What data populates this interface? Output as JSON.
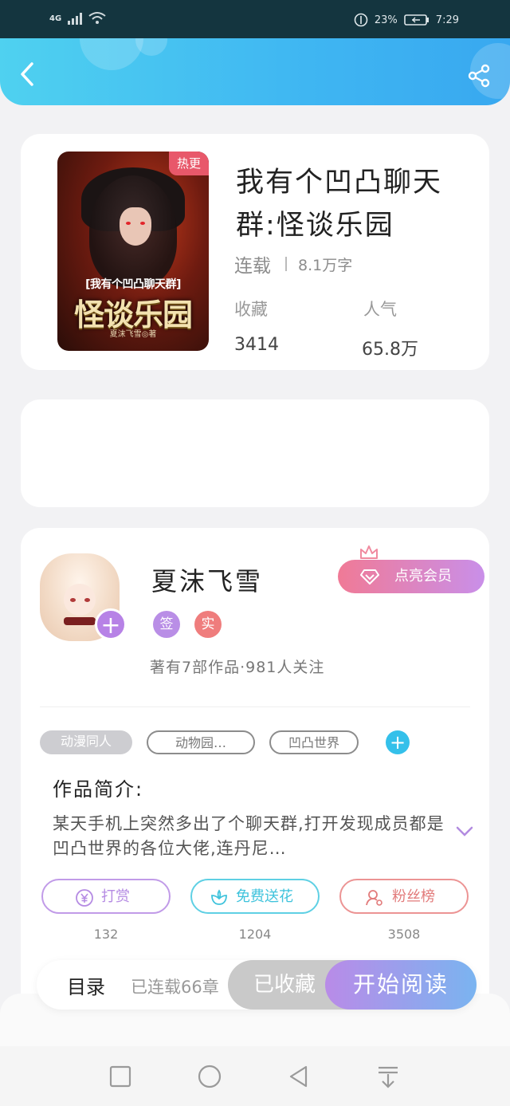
{
  "status_bar": {
    "network": "4G",
    "battery": "23%",
    "time": "7:29"
  },
  "book": {
    "title": "我有个凹凸聊天群:怪谈乐园",
    "status": "连载",
    "word_count": "8.1万字",
    "badge": "热更",
    "cover_subtitle": "[我有个凹凸聊天群]",
    "cover_title": "怪谈乐园",
    "cover_author": "夏沫飞雪◎著",
    "stats": {
      "favorites_label": "收藏",
      "favorites_value": "3414",
      "popularity_label": "人气",
      "popularity_value": "65.8万"
    }
  },
  "author": {
    "name": "夏沫飞雪",
    "tag_sign": "签",
    "tag_real": "实",
    "vip_button": "点亮会员",
    "summary": "著有7部作品·981人关注"
  },
  "tags": [
    "动漫同人",
    "动物园…",
    "凹凸世界"
  ],
  "intro": {
    "title": "作品简介:",
    "text": "某天手机上突然多出了个聊天群,打开发现成员都是凹凸世界的各位大佬,连丹尼…"
  },
  "actions": [
    {
      "label": "打赏",
      "count": "132",
      "color": "#b58be3"
    },
    {
      "label": "免费送花",
      "count": "1204",
      "color": "#3fc3dc"
    },
    {
      "label": "粉丝榜",
      "count": "3508",
      "color": "#e27b7b"
    }
  ],
  "read_bar": {
    "toc": "目录",
    "chapters": "已连载66章",
    "favorited": "已收藏",
    "start": "开始阅读"
  },
  "colors": {
    "header": "#3fb6f2",
    "accent_purple": "#b782e6",
    "accent_pink": "#f07a96"
  }
}
